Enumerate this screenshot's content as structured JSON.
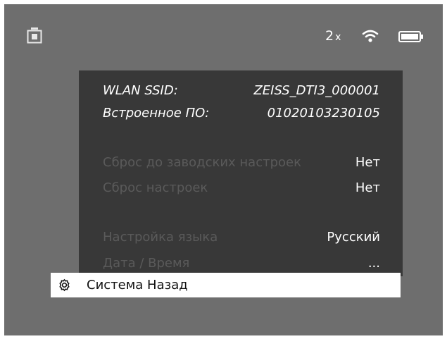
{
  "status_bar": {
    "zoom_value": "2",
    "zoom_unit": "x",
    "left_icon": "camera-icon",
    "wifi_icon": "wifi-icon",
    "battery_icon": "battery-icon"
  },
  "menu": {
    "info": [
      {
        "label": "WLAN SSID:",
        "value": "ZEISS_DTI3_000001"
      },
      {
        "label": "Встроенное ПО:",
        "value": "01020103230105"
      }
    ],
    "reset": [
      {
        "label": "Сброс до заводских настроек",
        "value": "Нет"
      },
      {
        "label": "Сброс настроек",
        "value": "Нет"
      }
    ],
    "other": [
      {
        "label": "Настройка языка",
        "value": "Русский"
      },
      {
        "label": "Дата / Время",
        "value": "..."
      }
    ]
  },
  "bottom_bar": {
    "icon": "gear-icon",
    "label": "Система Назад"
  }
}
